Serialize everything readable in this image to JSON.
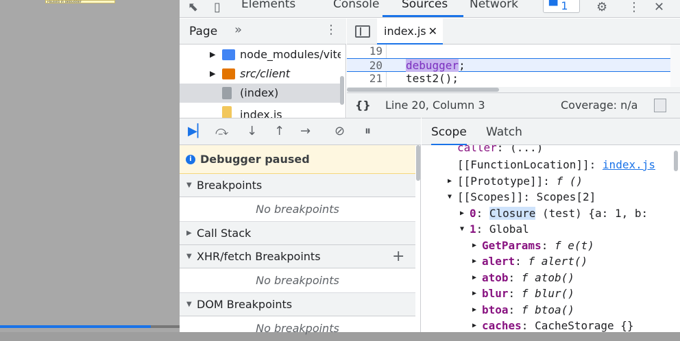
{
  "page": {
    "paused_badge": "Paused in debugger",
    "progress_fraction": 0.84
  },
  "topbar": {
    "tabs": [
      "Elements",
      "Console",
      "Sources",
      "Network"
    ],
    "active_tab": "Sources",
    "issues_count": "1"
  },
  "navigator": {
    "tab_label": "Page",
    "items": [
      {
        "label": "node_modules/vite",
        "type": "folder",
        "color": "#4285f4"
      },
      {
        "label": "src/client",
        "type": "folder",
        "color": "#e37400"
      },
      {
        "label": "(index)",
        "type": "file",
        "color": "#9aa0a6"
      },
      {
        "label": "index.js",
        "type": "file",
        "color": "#f2c75c"
      }
    ]
  },
  "editor": {
    "file_tab": "index.js",
    "lines": [
      {
        "num": "19",
        "code": ""
      },
      {
        "num": "20",
        "kw": "debugger",
        "rest": ";"
      },
      {
        "num": "21",
        "code": "test2();"
      }
    ],
    "status": {
      "braces": "{}",
      "position": "Line 20, Column 3",
      "coverage": "Coverage: n/a"
    }
  },
  "debugger": {
    "paused_text": "Debugger paused",
    "sections": {
      "breakpoints": "Breakpoints",
      "call_stack": "Call Stack",
      "xhr": "XHR/fetch Breakpoints",
      "dom": "DOM Breakpoints"
    },
    "empty_text": "No breakpoints"
  },
  "scope": {
    "tabs": [
      "Scope",
      "Watch"
    ],
    "rows": {
      "caller_key": "caller",
      "caller_val": ": (...)",
      "funcloc_key": "[[FunctionLocation]]: ",
      "funcloc_val": "index.js",
      "proto_key": "[[Prototype]]: ",
      "proto_val": "f ()",
      "scopes_key": "[[Scopes]]",
      "scopes_val": ": Scopes[2]",
      "closure_idx": "0",
      "closure_name": "Closure",
      "closure_rest": "(test) {a: 1, b:",
      "global_idx": "1",
      "global_name": "Global",
      "props": [
        {
          "key": "GetParams",
          "val": "f e(t)"
        },
        {
          "key": "alert",
          "val": "f alert()"
        },
        {
          "key": "atob",
          "val": "f atob()"
        },
        {
          "key": "blur",
          "val": "f blur()"
        },
        {
          "key": "btoa",
          "val": "f btoa()"
        },
        {
          "key": "caches",
          "val": "CacheStorage {}"
        }
      ]
    }
  }
}
